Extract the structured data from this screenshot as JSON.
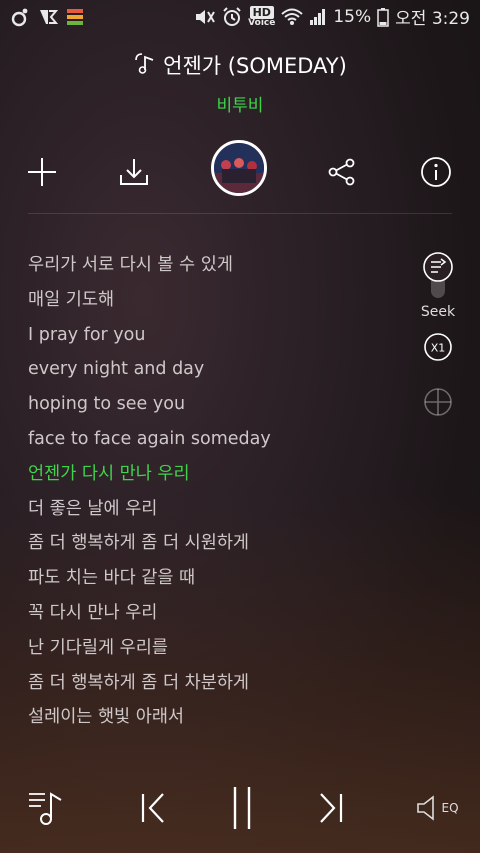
{
  "status_bar": {
    "hd_label": "HD",
    "voice_label": "Voice",
    "battery": "15%",
    "time": "오전 3:29"
  },
  "song": {
    "title": "언젠가 (SOMEDAY)",
    "artist": "비투비"
  },
  "actions": {
    "add_icon": "plus-icon",
    "download_icon": "download-icon",
    "share_icon": "share-icon",
    "info_icon": "info-icon"
  },
  "lyrics": [
    "우리가 서로 다시 볼 수 있게",
    "매일 기도해",
    "I pray for you",
    "every night and day",
    "hoping to see you",
    "face to face again someday",
    "언젠가 다시 만나 우리",
    "더 좋은 날에 우리",
    "좀 더 행복하게 좀 더 시원하게",
    "파도 치는 바다 같을 때",
    "꼭 다시 만나 우리",
    "난 기다릴게 우리를",
    "좀 더 행복하게 좀 더 차분하게",
    "설레이는 햇빛 아래서"
  ],
  "active_lyric_index": 6,
  "side_controls": {
    "seek_label": "Seek",
    "speed_label": "X1"
  },
  "playback": {
    "eq_label": "EQ"
  },
  "colors": {
    "accent": "#3fd34a",
    "lyric_text": "#cfc8c8"
  }
}
